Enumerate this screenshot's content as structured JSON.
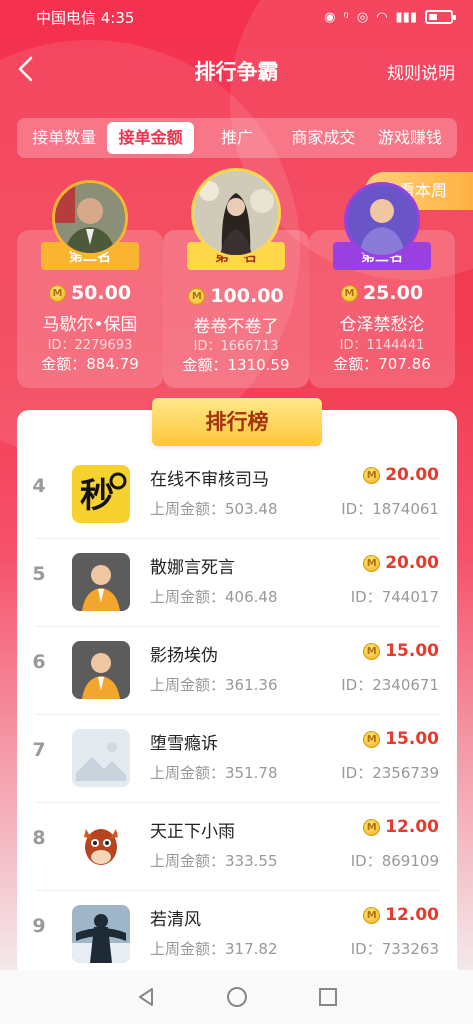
{
  "status": {
    "carrier_time": "中国电信 4:35"
  },
  "header": {
    "title": "排行争霸",
    "rules_label": "规则说明"
  },
  "tabs": [
    "接单数量",
    "接单金额",
    "推广",
    "商家成交",
    "游戏赚钱"
  ],
  "week_button": "查看本周",
  "podium": [
    {
      "rank_label": "第二名",
      "prize": "50.00",
      "name": "马歇尔•保国",
      "id": "ID：2279693",
      "amount": "金额：884.79"
    },
    {
      "rank_label": "第一名",
      "prize": "100.00",
      "name": "卷卷不卷了",
      "id": "ID：1666713",
      "amount": "金额：1310.59"
    },
    {
      "rank_label": "第三名",
      "prize": "25.00",
      "name": "仓泽禁愁沦",
      "id": "ID：1144441",
      "amount": "金额：707.86"
    }
  ],
  "leaderboard": {
    "title": "排行榜",
    "rows": [
      {
        "rank": "4",
        "name": "在线不审核司马",
        "amount": "20.00",
        "last_week": "上周金额：503.48",
        "id": "ID：1874061",
        "avatar": "miao-logo-icon"
      },
      {
        "rank": "5",
        "name": "散娜言死言",
        "amount": "20.00",
        "last_week": "上周金额：406.48",
        "id": "ID：744017",
        "avatar": "default-user-avatar-icon"
      },
      {
        "rank": "6",
        "name": "影扬埃伪",
        "amount": "15.00",
        "last_week": "上周金额：361.36",
        "id": "ID：2340671",
        "avatar": "default-user-avatar-icon"
      },
      {
        "rank": "7",
        "name": "堕雪瘾诉",
        "amount": "15.00",
        "last_week": "上周金额：351.78",
        "id": "ID：2356739",
        "avatar": "image-placeholder-icon"
      },
      {
        "rank": "8",
        "name": "天正下小雨",
        "amount": "12.00",
        "last_week": "上周金额：333.55",
        "id": "ID：869109",
        "avatar": "horse-cartoon-avatar"
      },
      {
        "rank": "9",
        "name": "若清风",
        "amount": "12.00",
        "last_week": "上周金额：317.82",
        "id": "ID：733263",
        "avatar": "silhouette-photo-avatar"
      }
    ]
  },
  "coin_letter": "M",
  "colors": {
    "accent": "#f0304c",
    "prize_red": "#e33b2e",
    "gold": "#ffc63a"
  }
}
